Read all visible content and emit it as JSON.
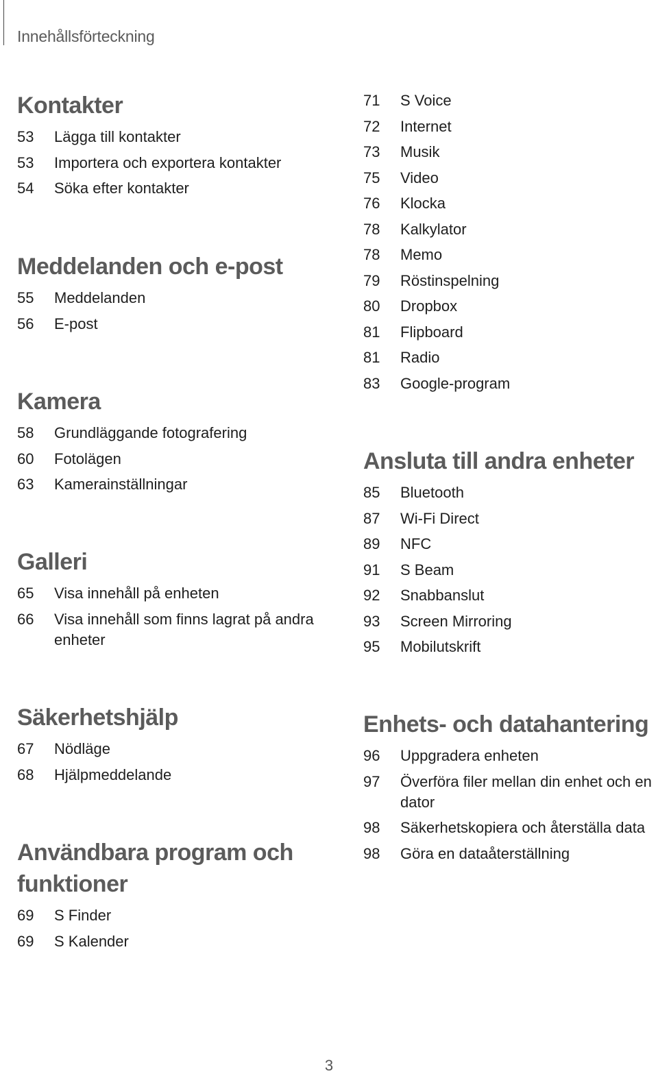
{
  "header": {
    "title": "Innehållsförteckning"
  },
  "sections": [
    {
      "heading": "Kontakter",
      "entries": [
        {
          "page": "53",
          "title": "Lägga till kontakter"
        },
        {
          "page": "53",
          "title": "Importera och exportera kontakter"
        },
        {
          "page": "54",
          "title": "Söka efter kontakter"
        }
      ]
    },
    {
      "heading": "Meddelanden och e-post",
      "entries": [
        {
          "page": "55",
          "title": "Meddelanden"
        },
        {
          "page": "56",
          "title": "E-post"
        }
      ]
    },
    {
      "heading": "Kamera",
      "entries": [
        {
          "page": "58",
          "title": "Grundläggande fotografering"
        },
        {
          "page": "60",
          "title": "Fotolägen"
        },
        {
          "page": "63",
          "title": "Kamerainställningar"
        }
      ]
    },
    {
      "heading": "Galleri",
      "entries": [
        {
          "page": "65",
          "title": "Visa innehåll på enheten"
        },
        {
          "page": "66",
          "title": "Visa innehåll som finns lagrat på andra enheter"
        }
      ]
    },
    {
      "heading": "Säkerhetshjälp",
      "entries": [
        {
          "page": "67",
          "title": "Nödläge"
        },
        {
          "page": "68",
          "title": "Hjälpmeddelande"
        }
      ]
    },
    {
      "heading": "Användbara program och funktioner",
      "entries": [
        {
          "page": "69",
          "title": "S Finder"
        },
        {
          "page": "69",
          "title": "S Kalender"
        },
        {
          "page": "71",
          "title": "S Voice"
        },
        {
          "page": "72",
          "title": "Internet"
        },
        {
          "page": "73",
          "title": "Musik"
        },
        {
          "page": "75",
          "title": "Video"
        },
        {
          "page": "76",
          "title": "Klocka"
        },
        {
          "page": "78",
          "title": "Kalkylator"
        },
        {
          "page": "78",
          "title": "Memo"
        },
        {
          "page": "79",
          "title": "Röstinspelning"
        },
        {
          "page": "80",
          "title": "Dropbox"
        },
        {
          "page": "81",
          "title": "Flipboard"
        },
        {
          "page": "81",
          "title": "Radio"
        },
        {
          "page": "83",
          "title": "Google-program"
        }
      ]
    },
    {
      "heading": "Ansluta till andra enheter",
      "entries": [
        {
          "page": "85",
          "title": "Bluetooth"
        },
        {
          "page": "87",
          "title": "Wi-Fi Direct"
        },
        {
          "page": "89",
          "title": "NFC"
        },
        {
          "page": "91",
          "title": "S Beam"
        },
        {
          "page": "92",
          "title": "Snabbanslut"
        },
        {
          "page": "93",
          "title": "Screen Mirroring"
        },
        {
          "page": "95",
          "title": "Mobilutskrift"
        }
      ]
    },
    {
      "heading": "Enhets- och datahantering",
      "entries": [
        {
          "page": "96",
          "title": "Uppgradera enheten"
        },
        {
          "page": "97",
          "title": "Överföra filer mellan din enhet och en dator"
        },
        {
          "page": "98",
          "title": "Säkerhetskopiera och återställa data"
        },
        {
          "page": "98",
          "title": "Göra en dataåterställning"
        }
      ]
    }
  ],
  "footer": {
    "page_number": "3"
  }
}
